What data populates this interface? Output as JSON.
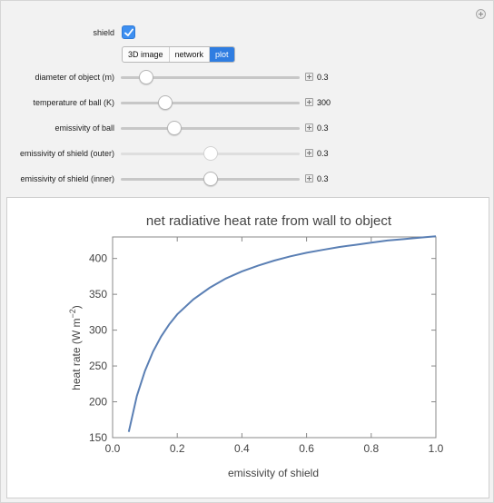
{
  "controls": {
    "shield": {
      "label": "shield",
      "checked": true
    },
    "view_mode": {
      "options": [
        "3D image",
        "network",
        "plot"
      ],
      "selected": "plot"
    },
    "sliders": [
      {
        "label": "diameter of object (m)",
        "value": "0.3",
        "position": 0.14,
        "enabled": true
      },
      {
        "label": "temperature of ball (K)",
        "value": "300",
        "position": 0.25,
        "enabled": true
      },
      {
        "label": "emissivity of ball",
        "value": "0.3",
        "position": 0.3,
        "enabled": true
      },
      {
        "label": "emissivity of shield (outer)",
        "value": "0.3",
        "position": 0.5,
        "enabled": false
      },
      {
        "label": "emissivity of shield (inner)",
        "value": "0.3",
        "position": 0.5,
        "enabled": true
      }
    ]
  },
  "colors": {
    "accent": "#3d8ff1",
    "curve": "#5a7fb4",
    "panel_bg": "#f2f2f2"
  },
  "chart_data": {
    "type": "line",
    "title": "net radiative heat rate from wall to object",
    "xlabel": "emissivity of shield",
    "ylabel_main": "heat rate (W m",
    "ylabel_sup": "−2",
    "ylabel_close": ")",
    "xlim": [
      0.0,
      1.0
    ],
    "ylim": [
      150,
      430
    ],
    "xticks": [
      "0.0",
      "0.2",
      "0.4",
      "0.6",
      "0.8",
      "1.0"
    ],
    "yticks": [
      "150",
      "200",
      "250",
      "300",
      "350",
      "400"
    ],
    "series": [
      {
        "x": [
          0.05,
          0.075,
          0.1,
          0.125,
          0.15,
          0.175,
          0.2,
          0.25,
          0.3,
          0.35,
          0.4,
          0.45,
          0.5,
          0.55,
          0.6,
          0.65,
          0.7,
          0.75,
          0.8,
          0.85,
          0.9,
          0.95,
          1.0
        ],
        "y": [
          158,
          208,
          243,
          270,
          291,
          308,
          322,
          343,
          359,
          372,
          382,
          390,
          397,
          403,
          408,
          412,
          416,
          419,
          422,
          425,
          427,
          429,
          431
        ]
      }
    ]
  }
}
